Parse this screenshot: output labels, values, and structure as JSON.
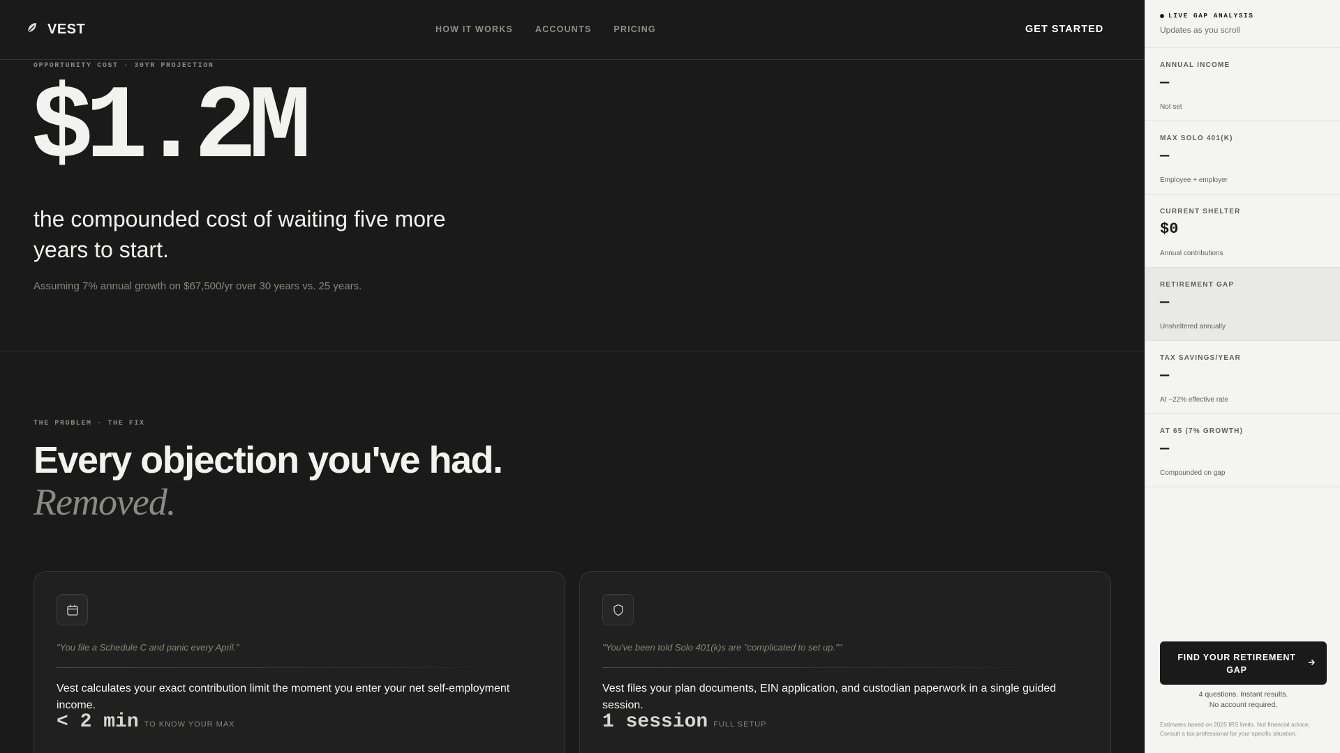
{
  "nav": {
    "logo_text": "VEST",
    "links": [
      "HOW IT WORKS",
      "ACCOUNTS",
      "PRICING"
    ],
    "cta": "GET STARTED"
  },
  "hero": {
    "eyebrow": "OPPORTUNITY COST · 30YR PROJECTION",
    "amount": "$1.2M",
    "lede": "the compounded cost of waiting five more years to start.",
    "note": "Assuming 7% annual growth on $67,500/yr over 30 years vs. 25 years."
  },
  "section": {
    "eyebrow": "THE PROBLEM · THE FIX",
    "title_main": "Every objection you've had.",
    "title_accent": "Removed."
  },
  "cards": [
    {
      "icon": "calendar-icon",
      "quote": "\"You file a Schedule C and panic every April.\"",
      "body": "Vest calculates your exact contribution limit the moment you enter your net self-employment income.",
      "stat_value": "< 2 min",
      "stat_label": "TO KNOW YOUR MAX"
    },
    {
      "icon": "shield-icon",
      "quote": "\"You've been told Solo 401(k)s are \"complicated to set up.\"\"",
      "body": "Vest files your plan documents, EIN application, and custodian paperwork in a single guided session.",
      "stat_value": "1 session",
      "stat_label": "FULL SETUP"
    }
  ],
  "panel": {
    "live_label": "LIVE GAP ANALYSIS",
    "subtitle": "Updates as you scroll",
    "metrics": [
      {
        "label": "ANNUAL INCOME",
        "value": "—",
        "note": "Not set"
      },
      {
        "label": "MAX SOLO 401(K)",
        "value": "—",
        "note": "Employee + employer"
      },
      {
        "label": "CURRENT SHELTER",
        "value": "$0",
        "note": "Annual contributions"
      },
      {
        "label": "RETIREMENT GAP",
        "value": "—",
        "note": "Unsheltered annually"
      },
      {
        "label": "TAX SAVINGS/YEAR",
        "value": "—",
        "note": "At ~22% effective rate"
      },
      {
        "label": "AT 65 (7% GROWTH)",
        "value": "—",
        "note": "Compounded on gap"
      }
    ],
    "button_label": "FIND YOUR RETIREMENT GAP",
    "button_note_1": "4 questions. Instant results.",
    "button_note_2": "No account required.",
    "disclaimer": "Estimates based on 2025 IRS limits. Not financial advice. Consult a tax professional for your specific situation."
  },
  "colors": {
    "background": "#1a1a1a",
    "panel": "#f4f4f2",
    "text": "#f2f2f0",
    "muted": "#8a8a86"
  }
}
